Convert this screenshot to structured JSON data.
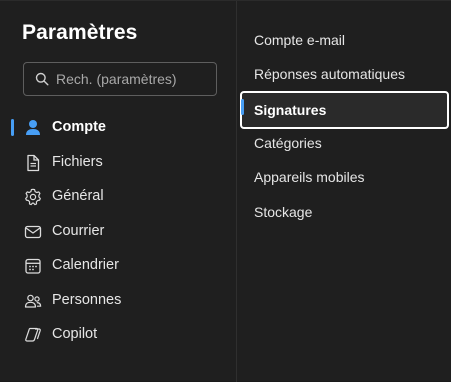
{
  "header": {
    "title": "Paramètres"
  },
  "search": {
    "placeholder": "Rech. (paramètres)"
  },
  "nav": {
    "items": [
      {
        "label": "Compte",
        "icon": "person-icon",
        "active": true
      },
      {
        "label": "Fichiers",
        "icon": "document-icon",
        "active": false
      },
      {
        "label": "Général",
        "icon": "gear-icon",
        "active": false
      },
      {
        "label": "Courrier",
        "icon": "mail-icon",
        "active": false
      },
      {
        "label": "Calendrier",
        "icon": "calendar-icon",
        "active": false
      },
      {
        "label": "Personnes",
        "icon": "people-icon",
        "active": false
      },
      {
        "label": "Copilot",
        "icon": "copilot-icon",
        "active": false
      }
    ]
  },
  "subnav": {
    "items": [
      {
        "label": "Compte e-mail",
        "active": false
      },
      {
        "label": "Réponses automatiques",
        "active": false
      },
      {
        "label": "Signatures",
        "active": true
      },
      {
        "label": "Catégories",
        "active": false
      },
      {
        "label": "Appareils mobiles",
        "active": false
      },
      {
        "label": "Stockage",
        "active": false
      }
    ]
  },
  "colors": {
    "accent": "#479ef5",
    "background": "#1f1f1f",
    "text": "#e6e6e6"
  }
}
